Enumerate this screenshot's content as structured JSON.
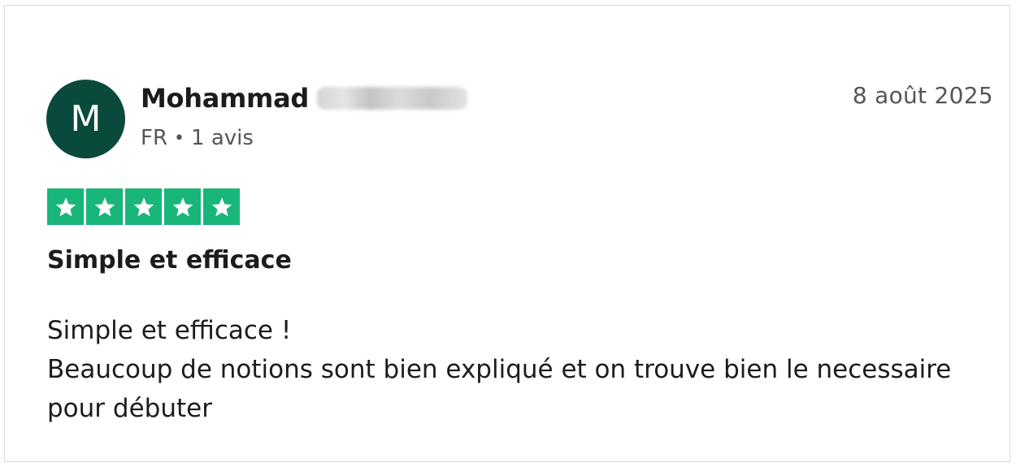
{
  "review": {
    "avatar_initial": "M",
    "reviewer_name": "Mohammad",
    "reviewer_country": "FR",
    "reviewer_review_count": "1 avis",
    "date": "8 août 2025",
    "rating": 5,
    "rating_max": 5,
    "star_color": "#19b67a",
    "avatar_color": "#0a4a3c",
    "title": "Simple et efficace",
    "body_lines": [
      "Simple et efficace !",
      "Beaucoup de notions sont bien expliqué et on trouve bien le necessaire",
      "pour débuter"
    ]
  }
}
